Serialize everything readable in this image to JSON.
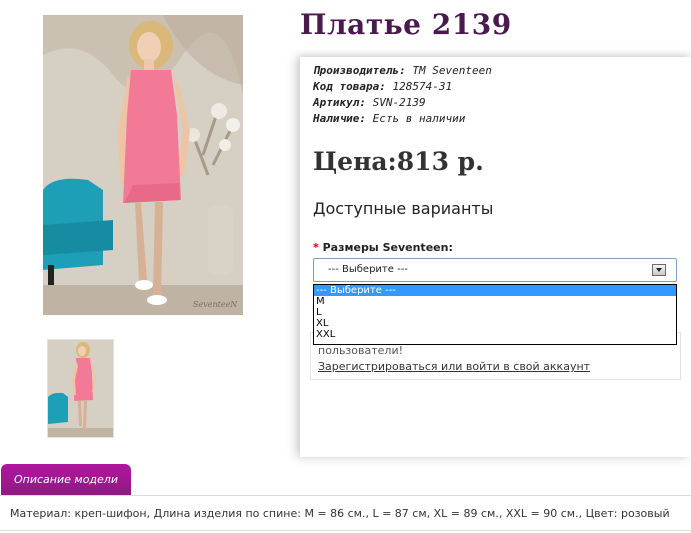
{
  "product": {
    "title": "Платье 2139",
    "manufacturer_label": "Производитель:",
    "manufacturer_value": "TM Seventeen",
    "code_label": "Код товара:",
    "code_value": "128574-31",
    "article_label": "Артикул:",
    "article_value": "SVN-2139",
    "availability_label": "Наличие:",
    "availability_value": "Есть в наличии",
    "price": "Цена:813 р."
  },
  "options": {
    "heading": "Доступные варианты",
    "size_label_required": "*",
    "size_label": "Размеры Seventeen:",
    "select_value": "--- Выберите ---",
    "dropdown_items": [
      "--- Выберите ---",
      "M",
      "L",
      "XL",
      "XXL"
    ]
  },
  "login": {
    "text": "пользователи!",
    "link": "Зарегистрироваться или войти в свой аккаунт"
  },
  "tabs": {
    "description": "Описание модели"
  },
  "description": {
    "text": "Материал: креп-шифон, Длина изделия по спине: M = 86 см., L = 87 см, XL = 89 см., XXL = 90 см., Цвет: розовый"
  },
  "photo": {
    "watermark": "SeventeeN"
  },
  "colors": {
    "title": "#4a1a4e",
    "tab": "#a2188f",
    "dress": "#f27a96",
    "chair": "#1d9fb8",
    "dropdown_highlight": "#3399ff"
  }
}
